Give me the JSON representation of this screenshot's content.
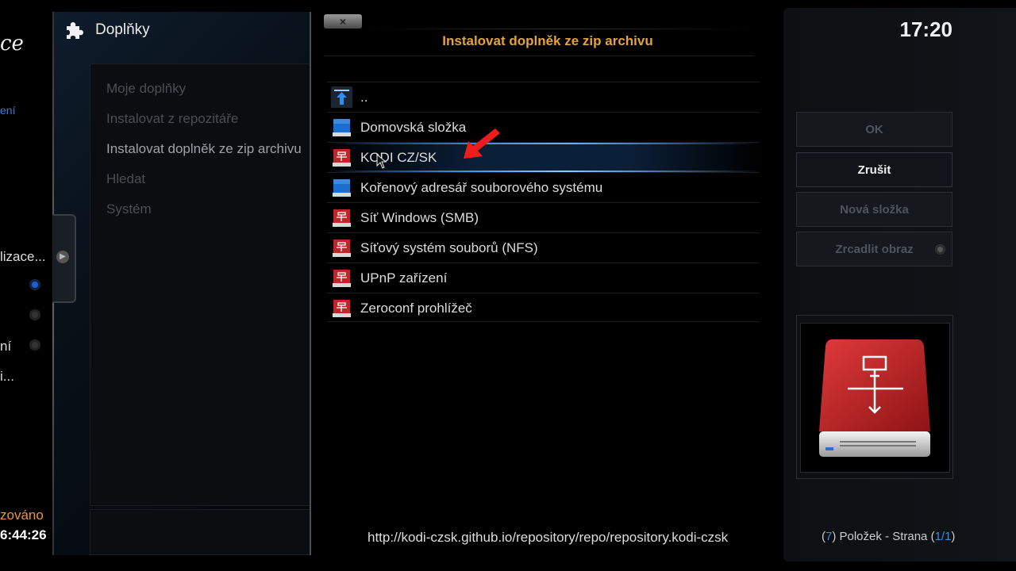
{
  "background_left": {
    "logo_fragment": "ce",
    "blue_fragment": "ení",
    "items": [
      "lizace...",
      "",
      "",
      "ní",
      "i..."
    ],
    "status_fragment": "zováno",
    "time_fragment": "6:44:26"
  },
  "addons": {
    "title": "Doplňky",
    "menu": [
      {
        "label": "Moje doplňky",
        "active": false
      },
      {
        "label": "Instalovat z repozitáře",
        "active": false
      },
      {
        "label": "Instalovat doplněk ze zip archivu",
        "active": true
      },
      {
        "label": "Hledat",
        "active": false
      },
      {
        "label": "Systém",
        "active": false
      }
    ]
  },
  "dialog": {
    "close_label": "×",
    "title": "Instalovat doplněk ze zip archivu",
    "files": [
      {
        "label": "..",
        "icon": "folder-up-icon"
      },
      {
        "label": "Domovská složka",
        "icon": "home-drive-icon"
      },
      {
        "label": "KODI CZ/SK",
        "icon": "network-drive-icon",
        "selected": true
      },
      {
        "label": "Kořenový adresář souborového systému",
        "icon": "root-drive-icon"
      },
      {
        "label": "Síť Windows (SMB)",
        "icon": "network-drive-icon"
      },
      {
        "label": "Síťový systém souborů (NFS)",
        "icon": "network-drive-icon"
      },
      {
        "label": "UPnP zařízení",
        "icon": "network-drive-icon"
      },
      {
        "label": "Zeroconf prohlížeč",
        "icon": "network-drive-icon"
      }
    ],
    "path": "http://kodi-czsk.github.io/repository/repo/repository.kodi-czsk"
  },
  "right_panel": {
    "clock": "17:20",
    "buttons": {
      "ok": "OK",
      "cancel": "Zrušit",
      "new_folder": "Nová složka",
      "mirror": "Zrcadlit obraz"
    },
    "thumbnail_icon": "network-drive-icon",
    "items_info": {
      "open1": "(",
      "count": "7",
      "mid": ") Položek - Strana (",
      "page": "1/1",
      "close": ")"
    }
  },
  "colors": {
    "title_accent": "#e5a33b",
    "selection_blue": "#3d8ae0",
    "drive_red": "#c0252a",
    "drive_blue": "#1a6fd0"
  }
}
